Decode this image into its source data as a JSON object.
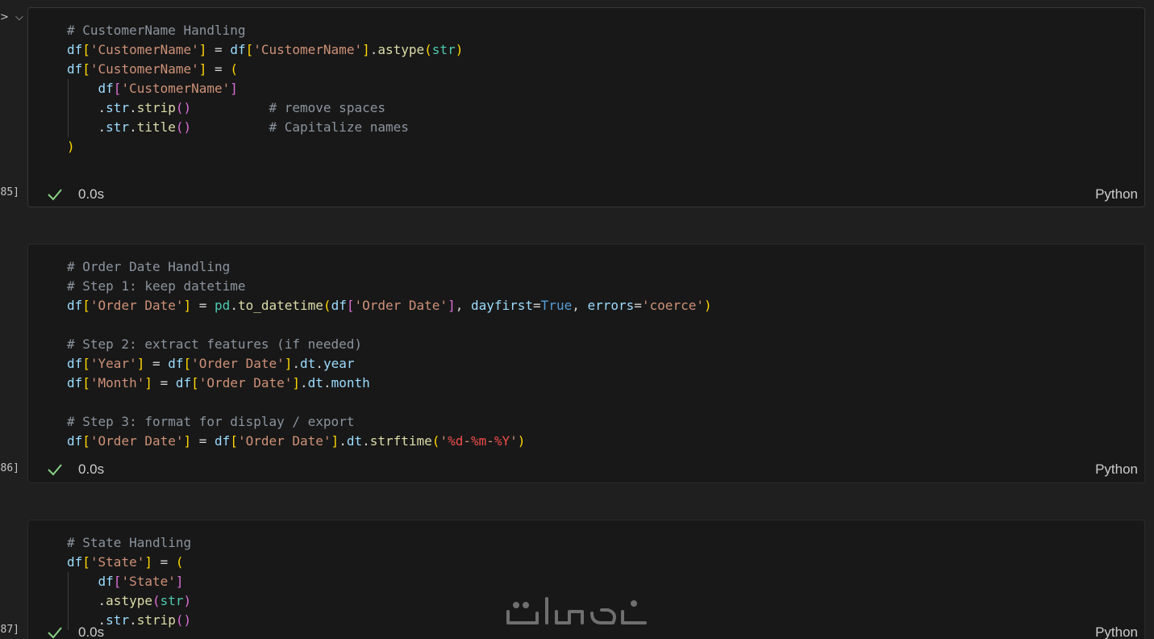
{
  "gutter": {
    "collapse_glyph": "> ⌵"
  },
  "cells": [
    {
      "exec_count": "85]",
      "status": {
        "duration": "0.0s",
        "language": "Python"
      },
      "lines": [
        [
          [
            "c",
            "# CustomerName Handling"
          ]
        ],
        [
          [
            "v",
            "df"
          ],
          [
            "b1",
            "["
          ],
          [
            "s",
            "'CustomerName'"
          ],
          [
            "b1",
            "]"
          ],
          [
            "o",
            " = "
          ],
          [
            "v",
            "df"
          ],
          [
            "b1",
            "["
          ],
          [
            "s",
            "'CustomerName'"
          ],
          [
            "b1",
            "]"
          ],
          [
            "o",
            "."
          ],
          [
            "f",
            "astype"
          ],
          [
            "b1",
            "("
          ],
          [
            "cl",
            "str"
          ],
          [
            "b1",
            ")"
          ]
        ],
        [
          [
            "v",
            "df"
          ],
          [
            "b1",
            "["
          ],
          [
            "s",
            "'CustomerName'"
          ],
          [
            "b1",
            "]"
          ],
          [
            "o",
            " = "
          ],
          [
            "b1",
            "("
          ]
        ],
        [
          [
            "g",
            ""
          ],
          [
            "o",
            "    "
          ],
          [
            "v",
            "df"
          ],
          [
            "b2",
            "["
          ],
          [
            "s",
            "'CustomerName'"
          ],
          [
            "b2",
            "]"
          ]
        ],
        [
          [
            "g",
            ""
          ],
          [
            "o",
            "    ."
          ],
          [
            "v",
            "str"
          ],
          [
            "o",
            "."
          ],
          [
            "f",
            "strip"
          ],
          [
            "b2",
            "()"
          ],
          [
            "o",
            "          "
          ],
          [
            "c",
            "# remove spaces"
          ]
        ],
        [
          [
            "g",
            ""
          ],
          [
            "o",
            "    ."
          ],
          [
            "v",
            "str"
          ],
          [
            "o",
            "."
          ],
          [
            "f",
            "title"
          ],
          [
            "b2",
            "()"
          ],
          [
            "o",
            "          "
          ],
          [
            "c",
            "# Capitalize names"
          ]
        ],
        [
          [
            "b1",
            ")"
          ]
        ]
      ]
    },
    {
      "exec_count": "86]",
      "status": {
        "duration": "0.0s",
        "language": "Python"
      },
      "lines": [
        [
          [
            "c",
            "# Order Date Handling"
          ]
        ],
        [
          [
            "c",
            "# Step 1: keep datetime"
          ]
        ],
        [
          [
            "v",
            "df"
          ],
          [
            "b1",
            "["
          ],
          [
            "s",
            "'Order Date'"
          ],
          [
            "b1",
            "]"
          ],
          [
            "o",
            " = "
          ],
          [
            "cl",
            "pd"
          ],
          [
            "o",
            "."
          ],
          [
            "f",
            "to_datetime"
          ],
          [
            "b1",
            "("
          ],
          [
            "v",
            "df"
          ],
          [
            "b2",
            "["
          ],
          [
            "s",
            "'Order Date'"
          ],
          [
            "b2",
            "]"
          ],
          [
            "o",
            ", "
          ],
          [
            "p",
            "dayfirst"
          ],
          [
            "o",
            "="
          ],
          [
            "k",
            "True"
          ],
          [
            "o",
            ", "
          ],
          [
            "p",
            "errors"
          ],
          [
            "o",
            "="
          ],
          [
            "s",
            "'coerce'"
          ],
          [
            "b1",
            ")"
          ]
        ],
        [],
        [
          [
            "c",
            "# Step 2: extract features (if needed)"
          ]
        ],
        [
          [
            "v",
            "df"
          ],
          [
            "b1",
            "["
          ],
          [
            "s",
            "'Year'"
          ],
          [
            "b1",
            "]"
          ],
          [
            "o",
            " = "
          ],
          [
            "v",
            "df"
          ],
          [
            "b1",
            "["
          ],
          [
            "s",
            "'Order Date'"
          ],
          [
            "b1",
            "]"
          ],
          [
            "o",
            "."
          ],
          [
            "v",
            "dt"
          ],
          [
            "o",
            "."
          ],
          [
            "v",
            "year"
          ]
        ],
        [
          [
            "v",
            "df"
          ],
          [
            "b1",
            "["
          ],
          [
            "s",
            "'Month'"
          ],
          [
            "b1",
            "]"
          ],
          [
            "o",
            " = "
          ],
          [
            "v",
            "df"
          ],
          [
            "b1",
            "["
          ],
          [
            "s",
            "'Order Date'"
          ],
          [
            "b1",
            "]"
          ],
          [
            "o",
            "."
          ],
          [
            "v",
            "dt"
          ],
          [
            "o",
            "."
          ],
          [
            "v",
            "month"
          ]
        ],
        [],
        [
          [
            "c",
            "# Step 3: format for display / export"
          ]
        ],
        [
          [
            "v",
            "df"
          ],
          [
            "b1",
            "["
          ],
          [
            "s",
            "'Order Date'"
          ],
          [
            "b1",
            "]"
          ],
          [
            "o",
            " = "
          ],
          [
            "v",
            "df"
          ],
          [
            "b1",
            "["
          ],
          [
            "s",
            "'Order Date'"
          ],
          [
            "b1",
            "]"
          ],
          [
            "o",
            "."
          ],
          [
            "v",
            "dt"
          ],
          [
            "o",
            "."
          ],
          [
            "f",
            "strftime"
          ],
          [
            "b1",
            "("
          ],
          [
            "s",
            "'"
          ],
          [
            "e",
            "%d"
          ],
          [
            "s",
            "-"
          ],
          [
            "e",
            "%m"
          ],
          [
            "s",
            "-"
          ],
          [
            "e",
            "%Y"
          ],
          [
            "s",
            "'"
          ],
          [
            "b1",
            ")"
          ]
        ]
      ]
    },
    {
      "exec_count": "87]",
      "status": {
        "duration": "0.0s",
        "language": "Python"
      },
      "lines": [
        [
          [
            "c",
            "# State Handling"
          ]
        ],
        [
          [
            "v",
            "df"
          ],
          [
            "b1",
            "["
          ],
          [
            "s",
            "'State'"
          ],
          [
            "b1",
            "]"
          ],
          [
            "o",
            " = "
          ],
          [
            "b1",
            "("
          ]
        ],
        [
          [
            "g",
            ""
          ],
          [
            "o",
            "    "
          ],
          [
            "v",
            "df"
          ],
          [
            "b2",
            "["
          ],
          [
            "s",
            "'State'"
          ],
          [
            "b2",
            "]"
          ]
        ],
        [
          [
            "g",
            ""
          ],
          [
            "o",
            "    ."
          ],
          [
            "f",
            "astype"
          ],
          [
            "b2",
            "("
          ],
          [
            "cl",
            "str"
          ],
          [
            "b2",
            ")"
          ]
        ],
        [
          [
            "g",
            ""
          ],
          [
            "o",
            "    ."
          ],
          [
            "v",
            "str"
          ],
          [
            "o",
            "."
          ],
          [
            "f",
            "strip"
          ],
          [
            "b2",
            "()"
          ]
        ]
      ]
    }
  ],
  "watermark": {
    "text": "خمسات",
    "color": "#6f6f6f"
  },
  "colors": {
    "background": "#1f1f1f",
    "cell_background": "#181818",
    "success_check": "#89d185"
  }
}
